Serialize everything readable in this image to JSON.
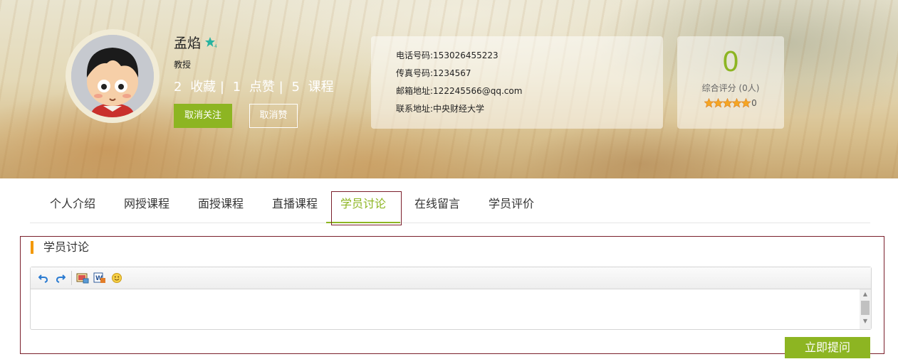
{
  "profile": {
    "name": "孟焰",
    "title": "教授",
    "stats": [
      {
        "count": "2",
        "label": "收藏 |"
      },
      {
        "count": "1",
        "label": "点赞 |"
      },
      {
        "count": "5",
        "label": "课程"
      }
    ],
    "follow_label": "取消关注",
    "unlike_label": "取消赞"
  },
  "contact": {
    "phone": "电话号码:153026455223",
    "fax": "传真号码:1234567",
    "email": "邮箱地址:122245566@qq.com",
    "address": "联系地址:中央财经大学"
  },
  "rating": {
    "score": "0",
    "label": "综合评分 (0人)",
    "stars_count": "0",
    "stars_value": 0,
    "stars_max": 5
  },
  "tabs": [
    {
      "label": "个人介绍"
    },
    {
      "label": "网授课程"
    },
    {
      "label": "面授课程"
    },
    {
      "label": "直播课程"
    },
    {
      "label": "学员讨论",
      "active": true
    },
    {
      "label": "在线留言"
    },
    {
      "label": "学员评价"
    }
  ],
  "discussion": {
    "section_title": "学员讨论",
    "editor_value": "",
    "toolbar": [
      "undo-icon",
      "redo-icon",
      "image-icon",
      "word-icon",
      "emoji-icon"
    ],
    "submit_label": "立即提问"
  },
  "colors": {
    "accent": "#8db522",
    "marker": "#f39800",
    "outline": "#7a1f2b"
  }
}
